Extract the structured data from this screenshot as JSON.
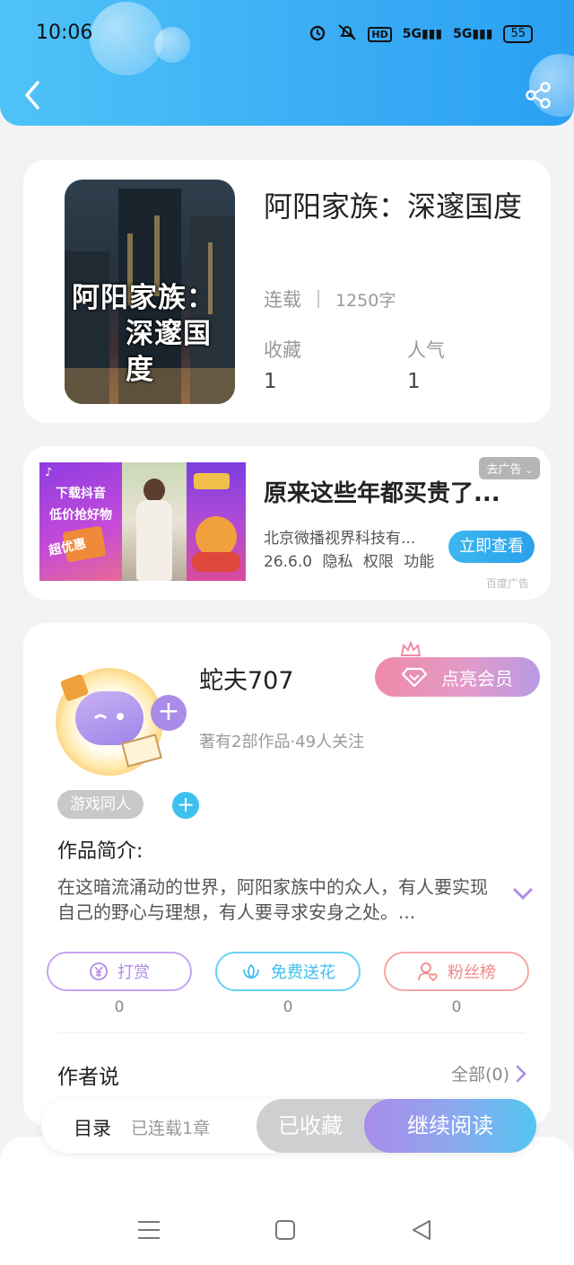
{
  "status_bar": {
    "time": "10:06",
    "network1": "5G",
    "network2": "5G",
    "battery": "55",
    "hd": "HD"
  },
  "book": {
    "cover_text_line1": "阿阳家族：",
    "cover_text_line2": "深邃国度",
    "title": "阿阳家族：深邃国度",
    "status": "连载",
    "word_count": "1250字",
    "favorites_label": "收藏",
    "favorites_value": "1",
    "popularity_label": "人气",
    "popularity_value": "1"
  },
  "ad": {
    "panel1_line1": "下载抖音",
    "panel1_line2": "低价抢好物",
    "panel1_badge": "超优惠",
    "remove_label": "去广告",
    "title": "原来这些年都买贵了...",
    "company": "北京微播视界科技有...",
    "meta": "26.6.0 隐私 权限 功能",
    "cta": "立即查看",
    "source": "百度广告"
  },
  "author": {
    "name": "蛇夫707",
    "subtitle": "著有2部作品·49人关注",
    "vip_label": "点亮会员",
    "genre_tag": "游戏同人",
    "intro_label": "作品简介:",
    "intro_text": "在这暗流涌动的世界，阿阳家族中的众人，有人要实现自己的野心与理想，有人要寻求安身之处。...",
    "actions": [
      {
        "label": "打赏",
        "count": "0"
      },
      {
        "label": "免费送花",
        "count": "0"
      },
      {
        "label": "粉丝榜",
        "count": "0"
      }
    ],
    "author_says_label": "作者说",
    "author_says_all": "全部(0)"
  },
  "bottom_bar": {
    "toc_label": "目录",
    "chapter_count": "已连载1章",
    "collected_label": "已收藏",
    "continue_label": "继续阅读"
  },
  "colors": {
    "accent": "#2aa0f3",
    "vip": "#f08aa6",
    "reward": "#b08ae6",
    "flower": "#3dc0ee",
    "fans": "#ef8a8a"
  }
}
